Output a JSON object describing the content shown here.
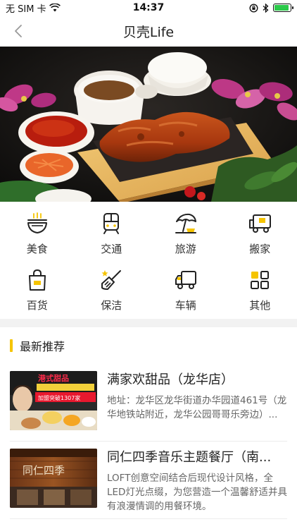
{
  "status_bar": {
    "carrier": "无 SIM 卡",
    "time": "14:37",
    "battery_percent": 90,
    "battery_color": "#2bc94a"
  },
  "nav": {
    "title": "贝壳Life",
    "back_icon": "chevron-left-icon"
  },
  "categories": [
    {
      "label": "美食",
      "icon": "food-bowl-icon"
    },
    {
      "label": "交通",
      "icon": "train-icon"
    },
    {
      "label": "旅游",
      "icon": "beach-umbrella-icon"
    },
    {
      "label": "搬家",
      "icon": "moving-truck-icon"
    },
    {
      "label": "百货",
      "icon": "shopping-bag-icon"
    },
    {
      "label": "保洁",
      "icon": "broom-icon"
    },
    {
      "label": "车辆",
      "icon": "truck-icon"
    },
    {
      "label": "其他",
      "icon": "grid-icon"
    }
  ],
  "accent_color": "#f5c400",
  "section": {
    "title": "最新推荐"
  },
  "shops": [
    {
      "name": "满家欢甜品（龙华店）",
      "desc": "地址：龙华区龙华街道办华园道461号（龙华地铁站附近，龙华公园哥哥乐旁边）...",
      "thumb_text_1": "港式甜品",
      "thumb_text_2": "加盟突破1307家"
    },
    {
      "name": "同仁四季音乐主题餐厅（南...",
      "desc": "LOFT创意空间结合后现代设计风格，全LED灯光点缀，为您营造一个温馨舒适并具有浪漫情调的用餐环境。",
      "thumb_text_1": "同仁四季"
    }
  ]
}
